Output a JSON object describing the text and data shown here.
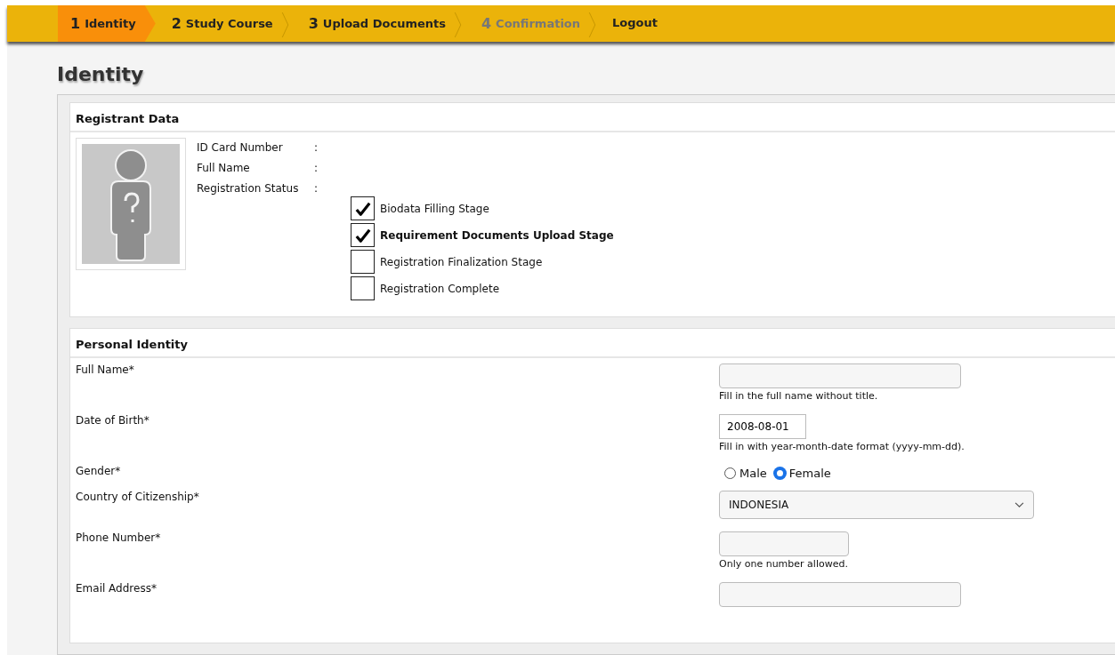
{
  "steps": [
    {
      "number": "1",
      "label": "Identity",
      "selected": true,
      "disabled": false
    },
    {
      "number": "2",
      "label": "Study Course",
      "selected": false,
      "disabled": false
    },
    {
      "number": "3",
      "label": "Upload Documents",
      "selected": false,
      "disabled": false
    },
    {
      "number": "4",
      "label": "Confirmation",
      "selected": false,
      "disabled": true
    }
  ],
  "logout": "Logout",
  "page_title": "Identity",
  "registrant": {
    "title": "Registrant Data",
    "info": [
      {
        "label": "ID Card Number",
        "separator": ":"
      },
      {
        "label": "Full Name",
        "separator": ":"
      },
      {
        "label": "Registration Status",
        "separator": ":"
      }
    ],
    "statuses": [
      {
        "label": "Biodata Filling Stage",
        "checked": true,
        "current": false
      },
      {
        "label": "Requirement Documents Upload Stage",
        "checked": true,
        "current": true
      },
      {
        "label": "Registration Finalization Stage",
        "checked": false,
        "current": false
      },
      {
        "label": "Registration Complete",
        "checked": false,
        "current": false
      }
    ]
  },
  "personal": {
    "title": "Personal Identity",
    "fields": [
      {
        "kind": "text",
        "label": "Full Name*",
        "hint": "Fill in the full name without title."
      },
      {
        "kind": "date",
        "label": "Date of Birth*",
        "value": "2008-08-01",
        "hint": "Fill in with year-month-date format (yyyy-mm-dd)."
      },
      {
        "kind": "radio",
        "label": "Gender*",
        "options": [
          {
            "label": "Male",
            "selected": false
          },
          {
            "label": "Female",
            "selected": true
          }
        ]
      },
      {
        "kind": "select",
        "label": "Country of Citizenship*",
        "value": "INDONESIA"
      },
      {
        "kind": "phone",
        "label": "Phone Number*",
        "hint": "Only one number allowed."
      },
      {
        "kind": "text",
        "label": "Email Address*"
      }
    ]
  }
}
